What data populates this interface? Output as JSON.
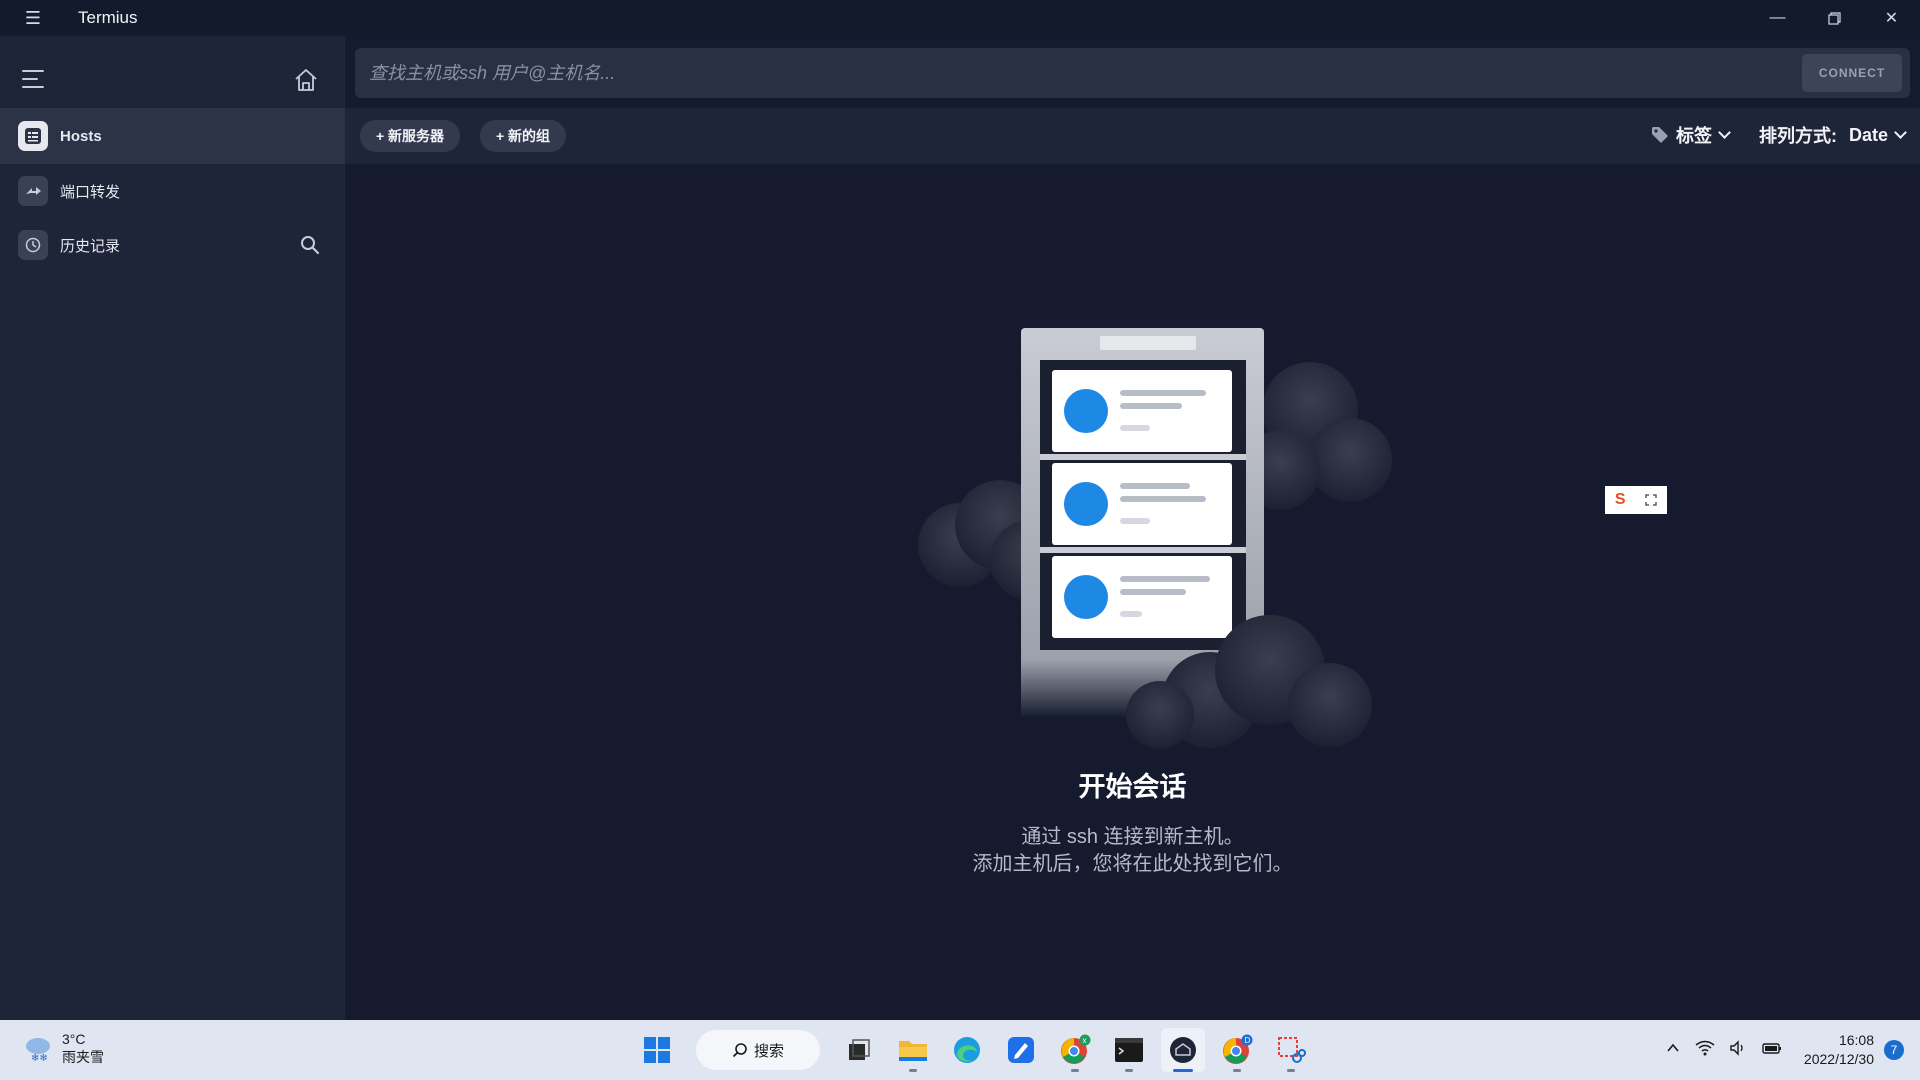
{
  "window": {
    "title": "Termius"
  },
  "sidebar": {
    "items": [
      {
        "label": "Hosts"
      },
      {
        "label": "端口转发"
      },
      {
        "label": "历史记录"
      }
    ]
  },
  "search": {
    "placeholder": "查找主机或ssh 用户@主机名...",
    "connect_label": "CONNECT"
  },
  "toolbar": {
    "new_server": "+ 新服务器",
    "new_group": "+ 新的组",
    "tags": "标签",
    "sort_label": "排列方式:",
    "sort_value": "Date"
  },
  "empty_state": {
    "title": "开始会话",
    "line1": "通过 ssh 连接到新主机。",
    "line2": "添加主机后，您将在此处找到它们。"
  },
  "taskbar": {
    "weather_temp": "3°C",
    "weather_desc": "雨夹雪",
    "search_label": "搜索",
    "time": "16:08",
    "date": "2022/12/30",
    "notification_count": "7"
  },
  "colors": {
    "accent_blue": "#1e88e5",
    "background": "#151a2e",
    "sidebar": "#1f2538"
  }
}
